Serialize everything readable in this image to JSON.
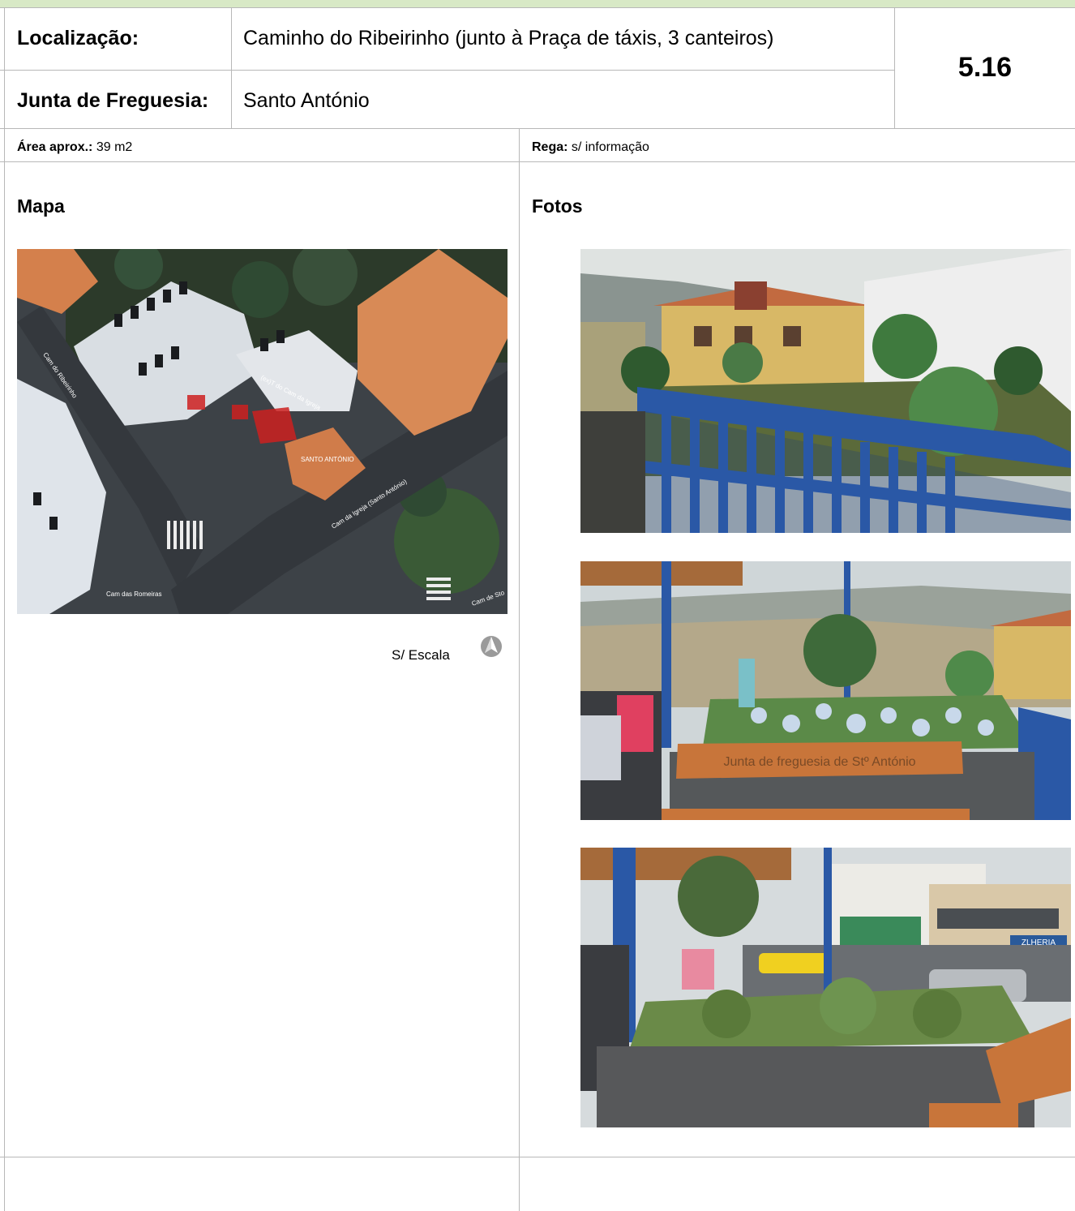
{
  "header": {
    "location_label": "Localização:",
    "location_value": "Caminho do Ribeirinho (junto à Praça de táxis, 3 canteiros)",
    "parish_label": "Junta de Freguesia:",
    "parish_value": "Santo António",
    "code": "5.16"
  },
  "info": {
    "area_label": "Área aprox.:",
    "area_value": " 39 m2",
    "irrigation_label": "Rega:",
    "irrigation_value": " s/ informação"
  },
  "map_section": {
    "title": "Mapa",
    "scale_text": "S/ Escala",
    "street_labels": [
      "Cam do Ribeirinho",
      "(ex)T do Cam da Igreja",
      "SANTO ANTÓNIO",
      "Cam da Igreja (Santo António)",
      "Cam das Romeiras",
      "Cam de Sto"
    ]
  },
  "photos_section": {
    "title": "Fotos",
    "bench_text": "Junta de freguesia de Stº António",
    "shop_sign": "ZLHERIA"
  },
  "colors": {
    "topbar": "#d8e9c6",
    "grid_line": "#b8b8b8",
    "railing_blue": "#2a58a6",
    "roof_orange": "#d4804c",
    "highlight_red": "#cc2020"
  },
  "icons": [
    "north-arrow-icon"
  ]
}
